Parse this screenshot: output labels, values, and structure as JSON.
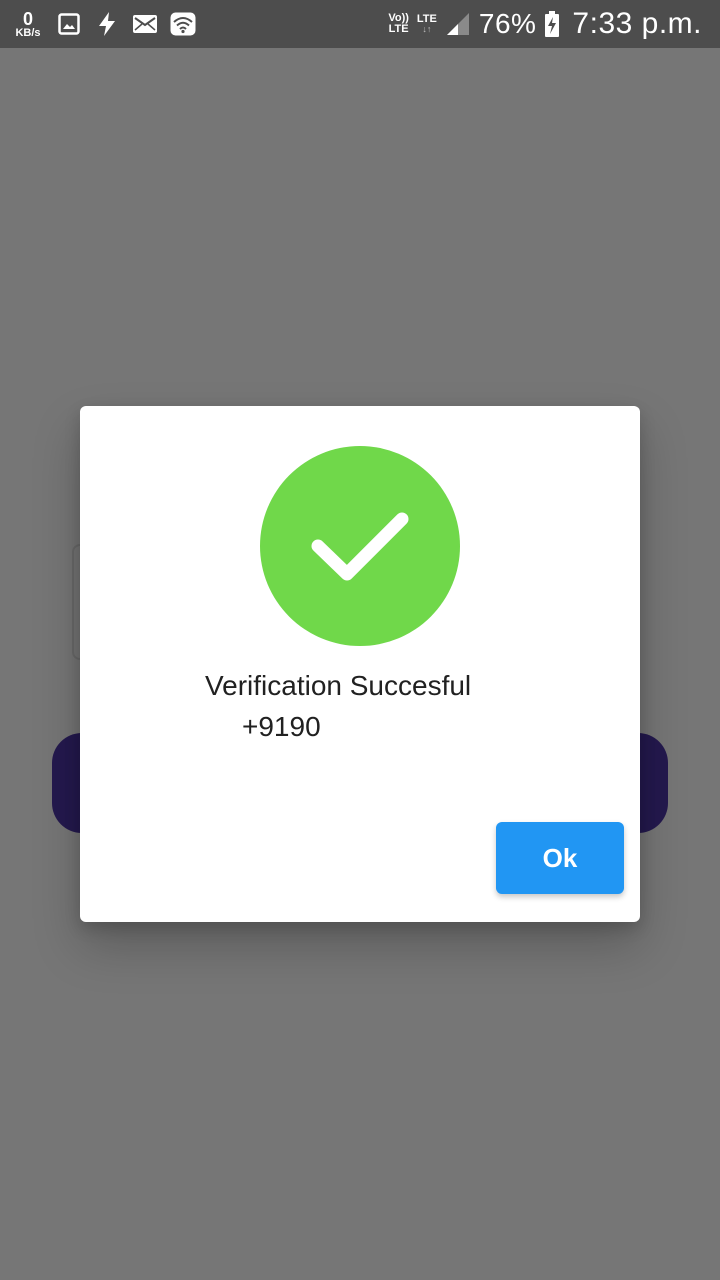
{
  "status_bar": {
    "net_speed_value": "0",
    "net_speed_unit": "KB/s",
    "icons_left": [
      "gallery-icon",
      "flash-icon",
      "mail-icon",
      "wifi-icon"
    ],
    "volte_top": "Vo))",
    "volte_bottom": "LTE",
    "lte_label": "LTE",
    "lte_arrows": "↓↑",
    "battery_percent": "76%",
    "time": "7:33 p.m."
  },
  "dialog": {
    "icon": "check-circle-icon",
    "icon_color": "#70d84a",
    "title": "Verification Succesful",
    "phone": "+9190",
    "ok_label": "Ok",
    "ok_color": "#2196f3"
  },
  "background": {
    "button_color": "#24194e"
  }
}
